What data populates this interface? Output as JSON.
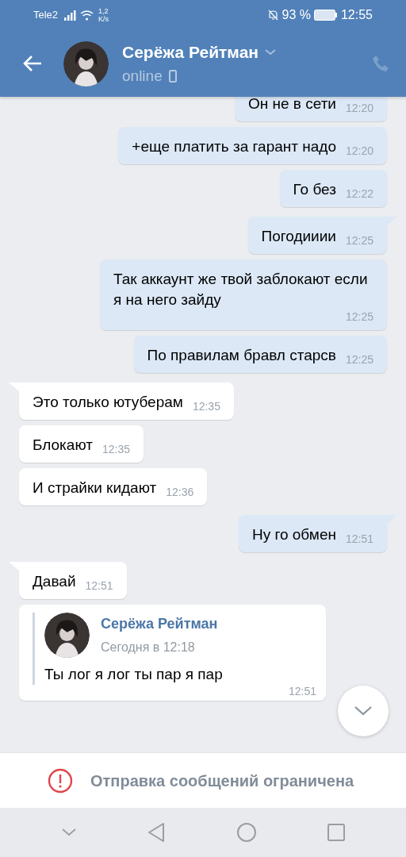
{
  "status_bar": {
    "carrier": "Tele2",
    "speed_value": "1,2",
    "speed_unit": "K/s",
    "battery": "93 %",
    "time": "12:55"
  },
  "header": {
    "name": "Серёжа Рейтман",
    "status": "online"
  },
  "messages": [
    {
      "kind": "out",
      "text": "Он не в сети",
      "time": "12:20"
    },
    {
      "kind": "out",
      "tail": false,
      "text": "+еще платить за гарант надо",
      "time": "12:20"
    },
    {
      "kind": "out",
      "tail": false,
      "text": "Го без",
      "time": "12:22"
    },
    {
      "kind": "out",
      "tail": true,
      "text": "Погодииии",
      "time": "12:25"
    },
    {
      "kind": "out",
      "tail": false,
      "text": "Так аккаунт же твой заблокают если я на него зайду",
      "time": "12:25"
    },
    {
      "kind": "out",
      "tail": false,
      "text": "По правилам бравл старсв",
      "time": "12:25"
    },
    {
      "kind": "in",
      "tail": true,
      "text": "Это только ютуберам",
      "time": "12:35"
    },
    {
      "kind": "in",
      "tail": false,
      "text": "Блокают",
      "time": "12:35"
    },
    {
      "kind": "in",
      "tail": false,
      "text": "И страйки кидают",
      "time": "12:36"
    },
    {
      "kind": "out",
      "tail": true,
      "text": "Ну го обмен",
      "time": "12:51"
    },
    {
      "kind": "in",
      "tail": true,
      "text": "Давай",
      "time": "12:51"
    },
    {
      "kind": "forward",
      "author": "Серёжа Рейтман",
      "date": "Сегодня в 12:18",
      "text": "Ты лог я лог ты пар я пар",
      "time": "12:51"
    }
  ],
  "notice": {
    "text": "Отправка сообщений ограничена"
  }
}
